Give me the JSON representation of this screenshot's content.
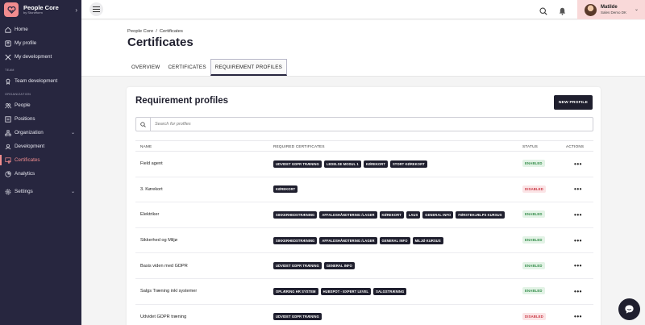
{
  "brand": {
    "title": "People Core",
    "subtitle": "by Stoneform"
  },
  "sidebar": {
    "top": [
      {
        "label": "Home"
      },
      {
        "label": "My profile"
      },
      {
        "label": "My development"
      }
    ],
    "sections": [
      {
        "title": "TEAM",
        "items": [
          {
            "label": "Team development"
          }
        ]
      },
      {
        "title": "ORGANIZATION",
        "items": [
          {
            "label": "People"
          },
          {
            "label": "Positions"
          },
          {
            "label": "Organization"
          },
          {
            "label": "Development"
          },
          {
            "label": "Certificates"
          },
          {
            "label": "Analytics"
          }
        ]
      }
    ],
    "settings": "Settings"
  },
  "user": {
    "name": "Matilde",
    "org": "Sales Demo DK"
  },
  "breadcrumb": {
    "root": "People Core",
    "separator": "/",
    "current": "Certificates"
  },
  "page_title": "Certificates",
  "tabs": [
    "OVERVIEW",
    "CERTIFICATES",
    "REQUIREMENT PROFILES"
  ],
  "card": {
    "title": "Requirement profiles",
    "new_button": "NEW PROFILE",
    "search_placeholder": "Search for profiles"
  },
  "table": {
    "headers": {
      "name": "NAME",
      "certs": "REQUIRED CERTIFICATES",
      "status": "STATUS",
      "actions": "ACTIONS"
    },
    "rows": [
      {
        "name": "Field agent",
        "certs": [
          "UDVIDET GDPR TRÆNING",
          "LEDELSE MODUL 1",
          "KØREKORT",
          "STORT KØREKORT"
        ],
        "status": "ENABLED"
      },
      {
        "name": "3. Kørekort",
        "certs": [
          "KØREKORT"
        ],
        "status": "DISABLED"
      },
      {
        "name": "Elektriker",
        "certs": [
          "SIKKERHEDSTRÆNING",
          "AFFALDSHÅNDTERING /LAGER",
          "KØREKORT",
          "LAUS",
          "GENERAL INFO",
          "FØRSTEHJÆLPS KURSUS"
        ],
        "status": "ENABLED"
      },
      {
        "name": "Sikkerhed og Miljø",
        "certs": [
          "SIKKERHEDSTRÆNING",
          "AFFALDSHÅNDTERING /LAGER",
          "GENERAL INFO",
          "MILJØ KURSUS"
        ],
        "status": "ENABLED"
      },
      {
        "name": "Basis viden med GDPR",
        "certs": [
          "UDVIDET GDPR TRÆNING",
          "GENERAL INFO"
        ],
        "status": "ENABLED"
      },
      {
        "name": "Salgs Træning inkl systemer",
        "certs": [
          "OPLÆRING HR SYSTEM",
          "HUBSPOT - EXPERT LEVEL",
          "SALGSTRÆNING"
        ],
        "status": "ENABLED"
      },
      {
        "name": "Udvidet GDPR træning",
        "certs": [
          "UDVIDET GDPR TRÆNING"
        ],
        "status": "DISABLED"
      }
    ],
    "actions_glyph": "•••"
  },
  "colors": {
    "sidebar_bg": "#27263f",
    "accent": "#f18c8e",
    "dark": "#1f1f2e",
    "enabled": "#2f8a46",
    "disabled": "#c8333f"
  }
}
